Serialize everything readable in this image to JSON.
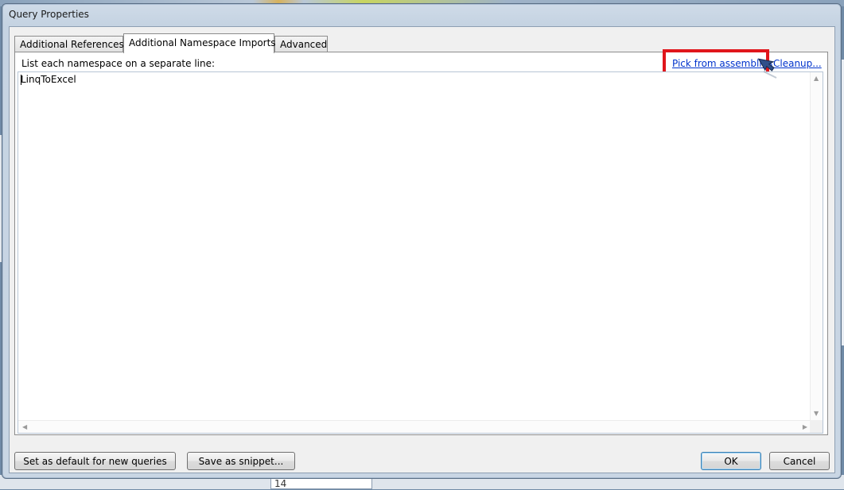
{
  "background": {
    "cell_value": "14"
  },
  "window": {
    "title": "Query Properties"
  },
  "tabs": [
    {
      "label": "Additional References",
      "active": false
    },
    {
      "label": "Additional Namespace Imports",
      "active": true
    },
    {
      "label": "Advanced",
      "active": false
    }
  ],
  "panel": {
    "caption": "List each namespace on a separate line:",
    "pick_link": "Pick from assemblies",
    "cleanup_link": "Cleanup...",
    "editor_text": "LinqToExcel"
  },
  "buttons": {
    "set_default": "Set as default for new queries",
    "save_snippet": "Save as snippet...",
    "ok": "OK",
    "cancel": "Cancel"
  },
  "colors": {
    "highlight": "#e0161b",
    "link": "#0033cc",
    "default_button_border": "#3c7fb1"
  },
  "icons": {
    "cursor": "hand-pointer-icon",
    "scroll_up": "triangle-up-icon",
    "scroll_down": "triangle-down-icon",
    "scroll_left": "triangle-left-icon",
    "scroll_right": "triangle-right-icon"
  }
}
